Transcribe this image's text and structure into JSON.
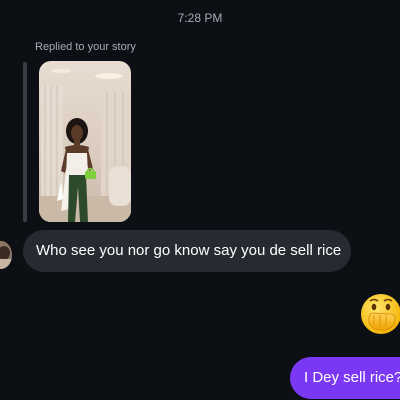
{
  "conversation": {
    "timestamp": "7:28 PM",
    "replied_label": "Replied to your story",
    "messages": [
      {
        "direction": "incoming",
        "text": "Who see you nor go know say you de sell rice"
      },
      {
        "direction": "outgoing",
        "emoji": "hand-over-mouth-emoji"
      },
      {
        "direction": "outgoing",
        "text": "I Dey sell rice?"
      }
    ]
  },
  "colors": {
    "background": "#0c0f14",
    "incoming_bubble": "#262a31",
    "outgoing_bubble": "#7a38f4",
    "meta_text": "#a7abb3"
  }
}
